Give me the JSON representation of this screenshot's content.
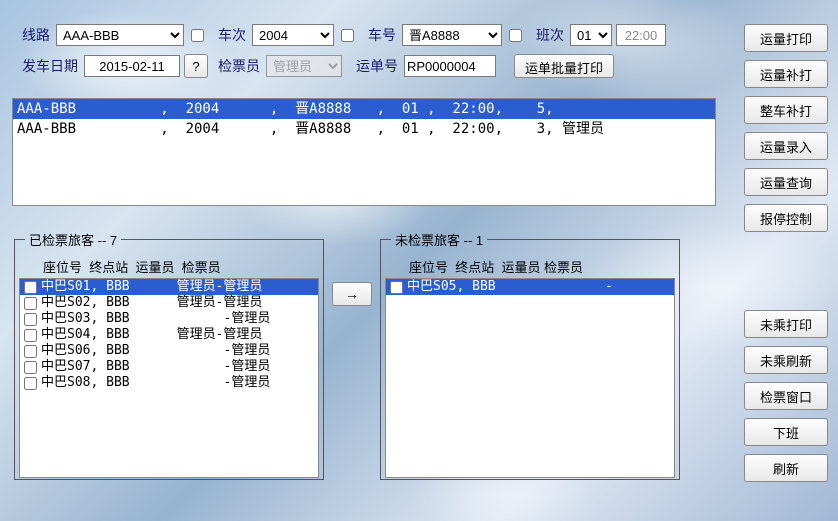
{
  "labels": {
    "route": "线路",
    "trip": "车次",
    "vehicle": "车号",
    "shift": "班次",
    "depart_date": "发车日期",
    "inspector": "检票员",
    "waybill": "运单号",
    "help": "?",
    "batch_print": "运单批量打印",
    "arrow": "→"
  },
  "form": {
    "route": "AAA-BBB",
    "trip": "2004",
    "vehicle": "晋A8888",
    "shift": "01",
    "time": "22:00",
    "depart_date": "2015-02-11",
    "inspector": "管理员",
    "waybill": "RP0000004"
  },
  "buttons": {
    "yl_print": "运量打印",
    "yl_reprint": "运量补打",
    "car_reprint": "整车补打",
    "yl_entry": "运量录入",
    "yl_query": "运量查询",
    "stop_ctrl": "报停控制",
    "nb_print": "未乘打印",
    "nb_refresh": "未乘刷新",
    "check_window": "检票窗口",
    "offduty": "下班",
    "refresh": "刷新"
  },
  "trips": [
    {
      "text": "AAA-BBB          ,  2004      ,  晋A8888   ,  01 ,  22:00,    5,",
      "selected": true
    },
    {
      "text": "AAA-BBB          ,  2004      ,  晋A8888   ,  01 ,  22:00,    3, 管理员",
      "selected": false
    }
  ],
  "checked": {
    "legend": "已检票旅客 -- 7",
    "header": "座位号  终点站  运量员  检票员",
    "rows": [
      {
        "text": "中巴S01, BBB      管理员-管理员",
        "selected": true
      },
      {
        "text": "中巴S02, BBB      管理员-管理员",
        "selected": false
      },
      {
        "text": "中巴S03, BBB            -管理员",
        "selected": false
      },
      {
        "text": "中巴S04, BBB      管理员-管理员",
        "selected": false
      },
      {
        "text": "中巴S06, BBB            -管理员",
        "selected": false
      },
      {
        "text": "中巴S07, BBB            -管理员",
        "selected": false
      },
      {
        "text": "中巴S08, BBB            -管理员",
        "selected": false
      }
    ]
  },
  "unchecked": {
    "legend": "未检票旅客 -- 1",
    "header": "座位号  终点站  运量员 检票员",
    "rows": [
      {
        "text": "中巴S05, BBB              -",
        "selected": true
      }
    ]
  }
}
